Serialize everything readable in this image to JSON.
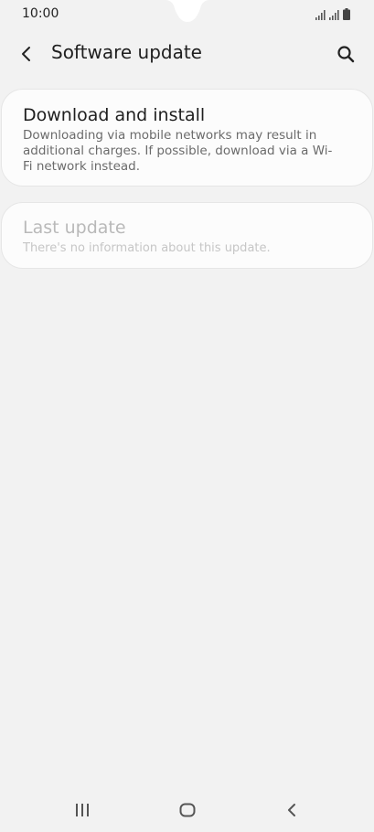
{
  "status_bar": {
    "time": "10:00"
  },
  "app_bar": {
    "title": "Software update",
    "back_icon": "chevron-left-icon",
    "search_icon": "search-icon"
  },
  "items": [
    {
      "title": "Download and install",
      "description": "Downloading via mobile networks may result in additional charges. If possible, download via a Wi-Fi network instead.",
      "enabled": true
    },
    {
      "title": "Last update",
      "description": "There's no information about this update.",
      "enabled": false
    }
  ],
  "nav_bar": {
    "recents_icon": "recents-icon",
    "home_icon": "home-icon",
    "back_icon": "back-icon"
  },
  "colors": {
    "background": "#f2f2f2",
    "card": "#fcfcfc",
    "text_primary": "#1f1f1f",
    "text_secondary": "#6b6b6b",
    "text_disabled": "#b9b9b9"
  }
}
